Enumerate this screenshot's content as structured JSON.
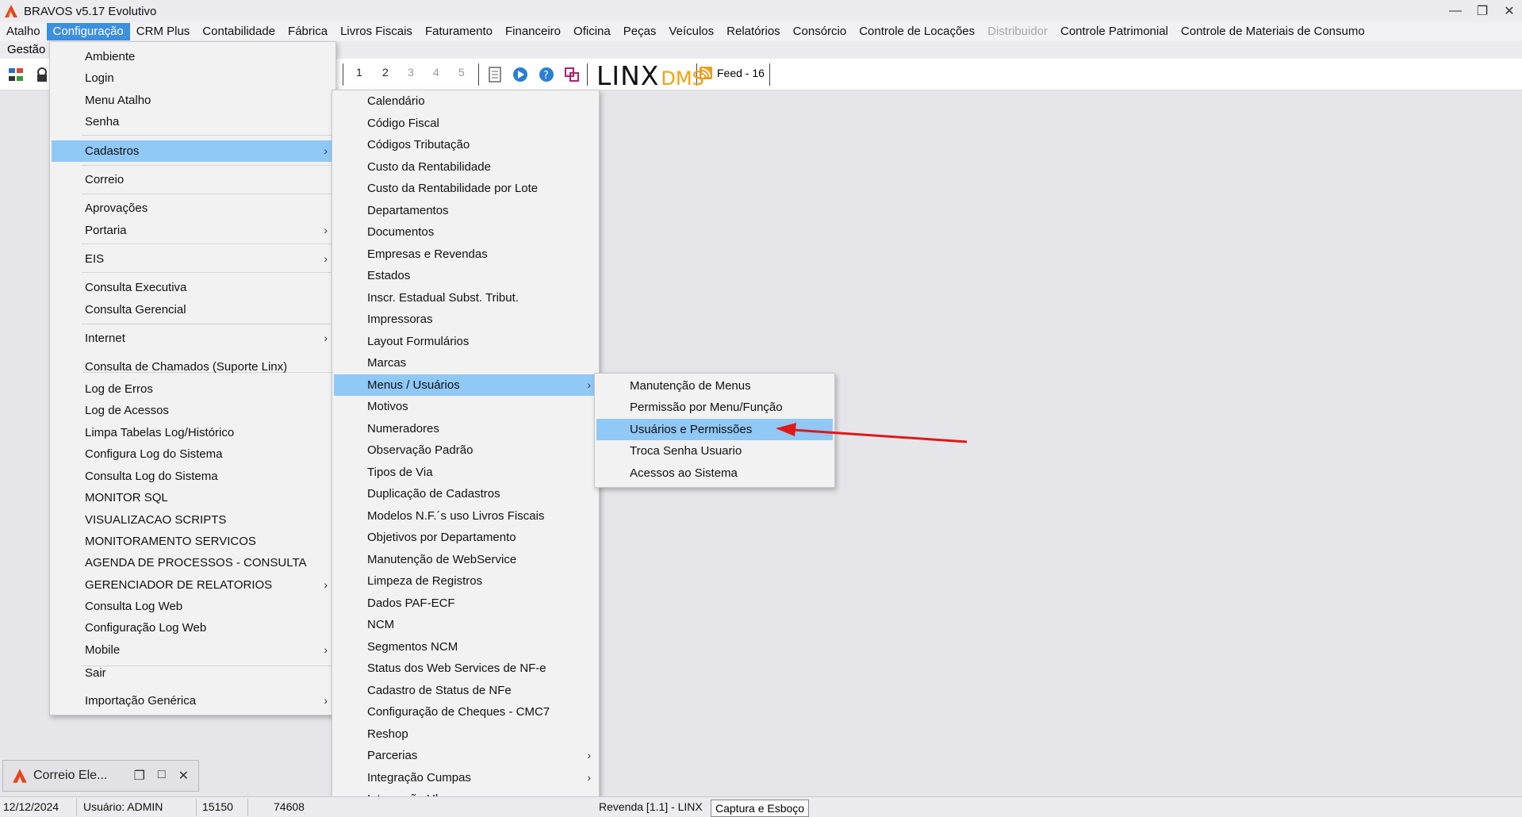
{
  "window": {
    "title": "BRAVOS v5.17 Evolutivo",
    "brand_color": "#e8431c"
  },
  "menubar": [
    {
      "label": "Atalho"
    },
    {
      "label": "Configuração",
      "active": true
    },
    {
      "label": "CRM Plus"
    },
    {
      "label": "Contabilidade"
    },
    {
      "label": "Fábrica"
    },
    {
      "label": "Livros Fiscais"
    },
    {
      "label": "Faturamento"
    },
    {
      "label": "Financeiro"
    },
    {
      "label": "Oficina"
    },
    {
      "label": "Peças"
    },
    {
      "label": "Veículos"
    },
    {
      "label": "Relatórios"
    },
    {
      "label": "Consórcio"
    },
    {
      "label": "Controle de Locações"
    },
    {
      "label": "Distribuidor",
      "disabled": true
    },
    {
      "label": "Controle Patrimonial"
    },
    {
      "label": "Controle de Materiais de Consumo"
    }
  ],
  "secondbar": {
    "label": "Gestão c"
  },
  "toolbar": {
    "pages": [
      "1",
      "2",
      "3",
      "4",
      "5"
    ],
    "logo_text": "LINX",
    "logo_suffix": "DMS",
    "feed_label": "Feed - 16"
  },
  "config_menu": [
    {
      "label": "Ambiente"
    },
    {
      "label": "Login"
    },
    {
      "label": "Menu Atalho"
    },
    {
      "label": "Senha"
    },
    {
      "separator": true
    },
    {
      "label": "Cadastros",
      "submenu": true,
      "active": true
    },
    {
      "separator": true
    },
    {
      "label": "Correio"
    },
    {
      "separator": true
    },
    {
      "label": "Aprovações"
    },
    {
      "label": "Portaria",
      "submenu": true
    },
    {
      "separator": true
    },
    {
      "label": "EIS",
      "submenu": true
    },
    {
      "separator": true
    },
    {
      "label": "Consulta Executiva"
    },
    {
      "label": "Consulta Gerencial"
    },
    {
      "separator": true
    },
    {
      "label": "Internet",
      "submenu": true
    },
    {
      "separator": true
    },
    {
      "label": "Consulta de Chamados (Suporte Linx)"
    },
    {
      "label": "Log de Erros"
    },
    {
      "label": "Log de Acessos"
    },
    {
      "label": "Limpa Tabelas Log/Histórico"
    },
    {
      "label": "Configura Log do Sistema"
    },
    {
      "label": "Consulta Log do Sistema"
    },
    {
      "label": "MONITOR SQL"
    },
    {
      "label": "VISUALIZACAO SCRIPTS"
    },
    {
      "label": "MONITORAMENTO SERVICOS"
    },
    {
      "label": "AGENDA DE PROCESSOS - CONSULTA"
    },
    {
      "label": "GERENCIADOR DE RELATORIOS",
      "submenu": true
    },
    {
      "label": "Consulta Log Web"
    },
    {
      "label": "Configuração Log Web"
    },
    {
      "label": "Mobile",
      "submenu": true
    },
    {
      "separator": true
    },
    {
      "label": "Sair"
    },
    {
      "label": "Importação Genérica",
      "submenu": true
    }
  ],
  "cadastros_menu": [
    {
      "label": "Calendário"
    },
    {
      "label": "Código Fiscal"
    },
    {
      "label": "Códigos Tributação"
    },
    {
      "label": "Custo da Rentabilidade"
    },
    {
      "label": "Custo da Rentabilidade por Lote"
    },
    {
      "label": "Departamentos"
    },
    {
      "label": "Documentos"
    },
    {
      "label": "Empresas e Revendas"
    },
    {
      "label": "Estados"
    },
    {
      "label": "Inscr. Estadual Subst. Tribut."
    },
    {
      "label": "Impressoras"
    },
    {
      "label": "Layout Formulários"
    },
    {
      "label": "Marcas"
    },
    {
      "label": "Menus / Usuários",
      "submenu": true,
      "active": true
    },
    {
      "label": "Motivos"
    },
    {
      "label": "Numeradores"
    },
    {
      "label": "Observação Padrão"
    },
    {
      "label": "Tipos de Via"
    },
    {
      "label": "Duplicação de Cadastros"
    },
    {
      "label": "Modelos N.F.´s uso Livros Fiscais"
    },
    {
      "label": "Objetivos por Departamento"
    },
    {
      "label": "Manutenção de WebService"
    },
    {
      "label": "Limpeza de Registros"
    },
    {
      "label": "Dados PAF-ECF"
    },
    {
      "label": "NCM"
    },
    {
      "label": "Segmentos NCM"
    },
    {
      "label": "Status dos Web Services de NF-e"
    },
    {
      "label": "Cadastro de Status de NFe"
    },
    {
      "label": "Configuração de Cheques - CMC7"
    },
    {
      "label": "Reshop"
    },
    {
      "label": "Parcerias",
      "submenu": true
    },
    {
      "label": "Integração Cumpas",
      "submenu": true
    },
    {
      "label": "Integração Uber",
      "submenu": true
    }
  ],
  "usuarios_menu": [
    {
      "label": "Manutenção de Menus"
    },
    {
      "label": "Permissão por Menu/Função"
    },
    {
      "label": "Usuários e Permissões",
      "active": true
    },
    {
      "label": "Troca Senha Usuario"
    },
    {
      "label": "Acessos ao Sistema"
    }
  ],
  "mini_window": {
    "title": "Correio Ele..."
  },
  "statusbar": {
    "date": "12/12/2024",
    "user": "Usuário: ADMIN",
    "code1": "15150",
    "code2": "74608",
    "revenda": "Revenda [1.1] - LINX",
    "capture": "Captura e Esboço"
  }
}
